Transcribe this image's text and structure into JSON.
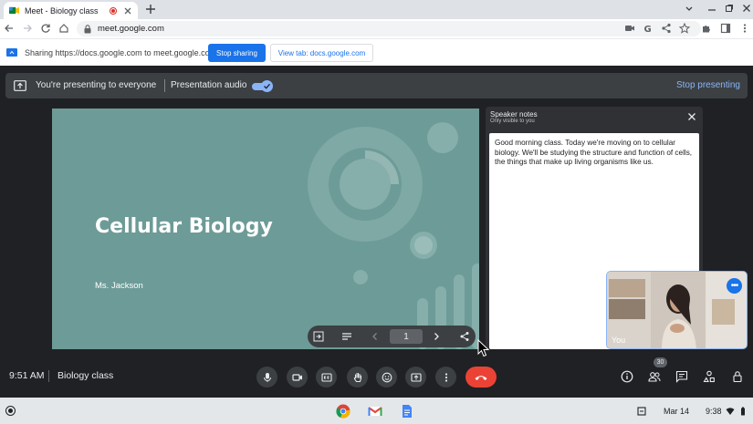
{
  "browser": {
    "tab_title": "Meet - Biology class",
    "url": "meet.google.com"
  },
  "infobar": {
    "message": "Sharing https://docs.google.com to meet.google.com",
    "stop_sharing": "Stop sharing",
    "view_tab": "View tab: docs.google.com"
  },
  "present_bar": {
    "status": "You're presenting to everyone",
    "audio_label": "Presentation audio",
    "audio_enabled": true,
    "stop_presenting": "Stop presenting"
  },
  "slide": {
    "title": "Cellular Biology",
    "author": "Ms. Jackson",
    "page": "1",
    "background_color": "#6d9b97"
  },
  "speaker_notes": {
    "heading": "Speaker notes",
    "subheading": "Only visible to you",
    "text": "Good morning class. Today we're moving on to cellular biology. We'll be studying the structure and function of cells, the things that make up living organisms like us."
  },
  "self_view": {
    "label": "You"
  },
  "meeting": {
    "time": "9:51 AM",
    "name": "Biology class",
    "participant_count": "30"
  },
  "shelf": {
    "date": "Mar 14",
    "time": "9:38"
  },
  "colors": {
    "accent": "#1a73e8",
    "leave": "#ea4335",
    "meet_bg": "#202124"
  }
}
